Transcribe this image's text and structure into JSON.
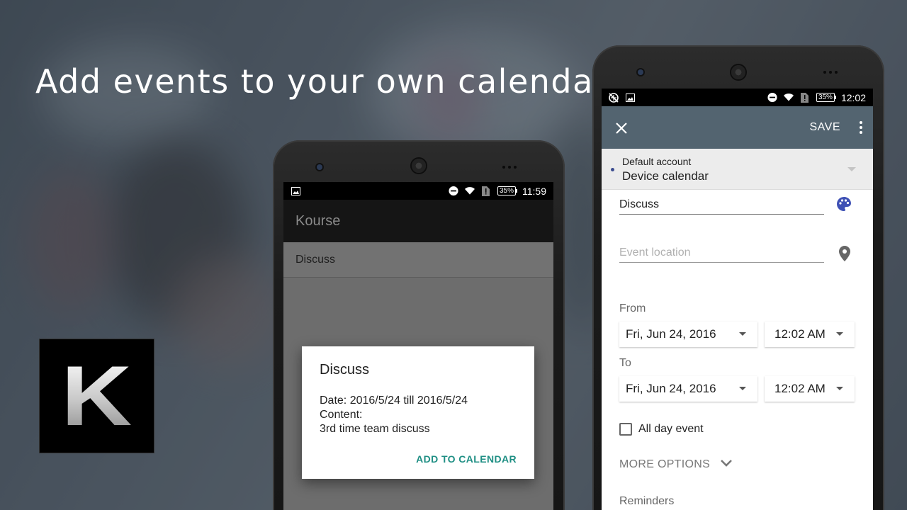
{
  "headline": "Add events to your own calendar",
  "logo": {
    "letter": "K"
  },
  "colors": {
    "calendar_toolbar": "#536470",
    "dialog_action": "#1f8f84",
    "palette_icon": "#3f51b5"
  },
  "phone_left": {
    "status": {
      "time": "11:59",
      "battery": "35%",
      "icons": [
        "image-icon",
        "do-not-disturb-icon",
        "wifi-icon",
        "sim-icon",
        "battery-icon"
      ]
    },
    "app_title": "Kourse",
    "list_items": [
      "Discuss"
    ],
    "dialog": {
      "title": "Discuss",
      "date_line": "Date: 2016/5/24 till 2016/5/24",
      "content_label": "Content:",
      "content_value": "3rd time team discuss",
      "action": "ADD TO CALENDAR"
    }
  },
  "phone_right": {
    "status": {
      "time": "12:02",
      "battery": "35%",
      "icons": [
        "location-off-icon",
        "image-icon",
        "do-not-disturb-icon",
        "wifi-icon",
        "sim-icon",
        "battery-icon"
      ]
    },
    "toolbar": {
      "close_icon": "close-icon",
      "save_label": "SAVE",
      "menu_icon": "more-vert-icon"
    },
    "account": {
      "label": "Default account",
      "value": "Device calendar"
    },
    "title_value": "Discuss",
    "location_placeholder": "Event location",
    "from_label": "From",
    "from_date": "Fri, Jun 24, 2016",
    "from_time": "12:02 AM",
    "to_label": "To",
    "to_date": "Fri, Jun 24, 2016",
    "to_time": "12:02 AM",
    "all_day_label": "All day event",
    "all_day_checked": false,
    "more_options": "MORE OPTIONS",
    "reminders_label": "Reminders"
  }
}
